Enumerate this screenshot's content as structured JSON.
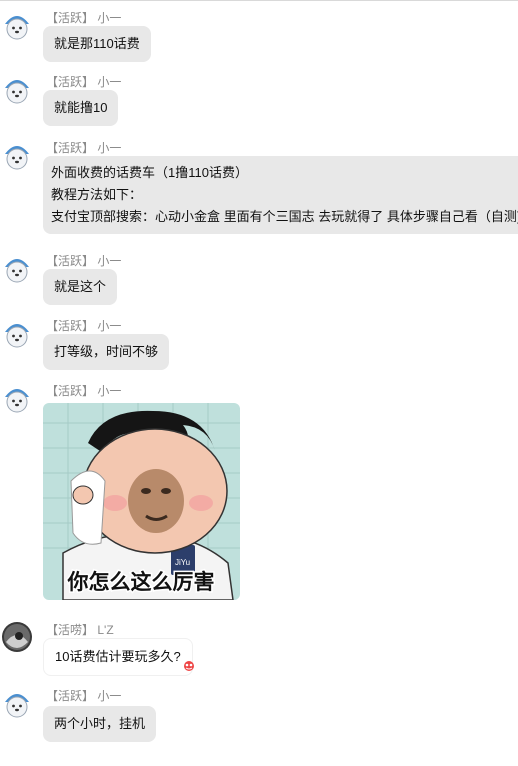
{
  "messages": [
    {
      "tag": "【活跃】",
      "name": "小一",
      "text": "就是那110话费"
    },
    {
      "tag": "【活跃】",
      "name": "小一",
      "text": "就能撸10"
    },
    {
      "tag": "【活跃】",
      "name": "小一",
      "lines": [
        "外面收费的话费车（1撸110话费）",
        "教程方法如下：",
        "支付宝顶部搜索：心动小金盒 里面有个三国志 去玩就得了 具体步骤自己看（自测)"
      ]
    },
    {
      "tag": "【活跃】",
      "name": "小一",
      "text": "就是这个"
    },
    {
      "tag": "【活跃】",
      "name": "小一",
      "text": "打等级，时间不够"
    },
    {
      "tag": "【活跃】",
      "name": "小一",
      "sticker_caption": "你怎么这么厉害",
      "sticker_shirt": "JiYu"
    },
    {
      "tag": "【活唠】",
      "name": "L'Z",
      "text": "10话费估计要玩多久?"
    },
    {
      "tag": "【活跃】",
      "name": "小一",
      "text": "两个小时，挂机"
    }
  ],
  "colors": {
    "bubble": "#e8e8e8",
    "header": "#8a8a8a",
    "avatar_hat": "#4a8fd0"
  }
}
